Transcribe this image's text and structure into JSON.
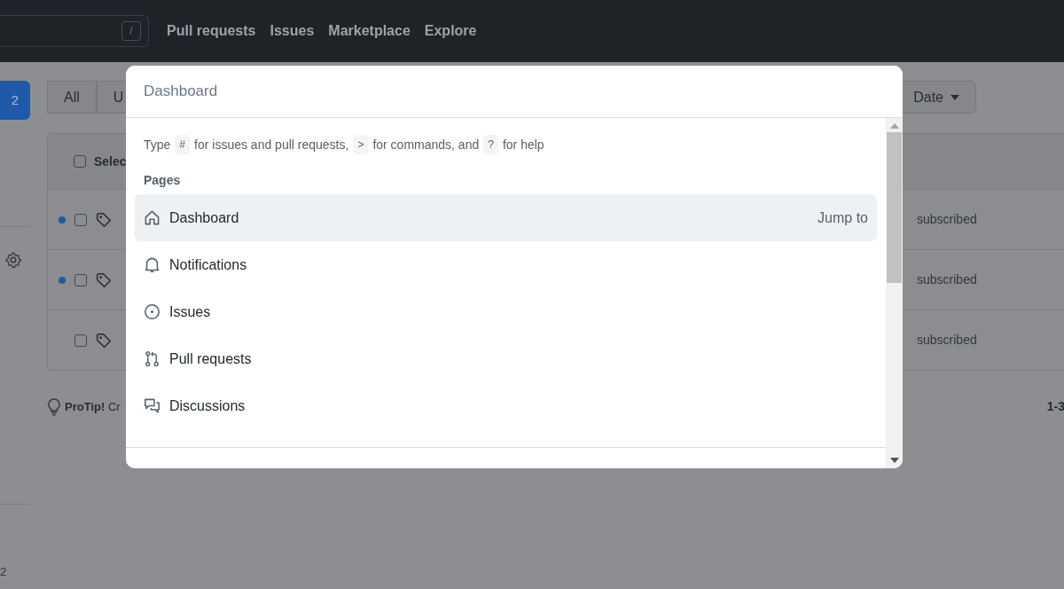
{
  "header": {
    "search_key": "/",
    "nav": [
      "Pull requests",
      "Issues",
      "Marketplace",
      "Explore"
    ]
  },
  "sidebar": {
    "count_button": "2",
    "footer_count": "2"
  },
  "filters": {
    "buttons": [
      "All",
      "U"
    ],
    "sort": "Date"
  },
  "table": {
    "select_label": "Selec",
    "select_checked": false,
    "rows": [
      {
        "unread": true,
        "checked": false,
        "reason": "subscribed"
      },
      {
        "unread": true,
        "checked": false,
        "reason": "subscribed"
      },
      {
        "unread": false,
        "checked": false,
        "reason": "subscribed"
      }
    ]
  },
  "protip": {
    "label": "ProTip!",
    "text": "Cr"
  },
  "pagination": "1-3",
  "palette": {
    "placeholder": "Dashboard",
    "hint": [
      {
        "kind": "text",
        "text": "Type"
      },
      {
        "kind": "key",
        "text": "#"
      },
      {
        "kind": "text",
        "text": "for issues and pull requests,"
      },
      {
        "kind": "key",
        "text": ">"
      },
      {
        "kind": "text",
        "text": "for commands, and"
      },
      {
        "kind": "key",
        "text": "?"
      },
      {
        "kind": "text",
        "text": "for help"
      }
    ],
    "section": "Pages",
    "items": [
      {
        "kind": "home",
        "label": "Dashboard",
        "selected": true,
        "action": "Jump to"
      },
      {
        "kind": "bell",
        "label": "Notifications",
        "selected": false
      },
      {
        "kind": "issue",
        "label": "Issues",
        "selected": false
      },
      {
        "kind": "pull",
        "label": "Pull requests",
        "selected": false
      },
      {
        "kind": "discussion",
        "label": "Discussions",
        "selected": false
      }
    ]
  }
}
